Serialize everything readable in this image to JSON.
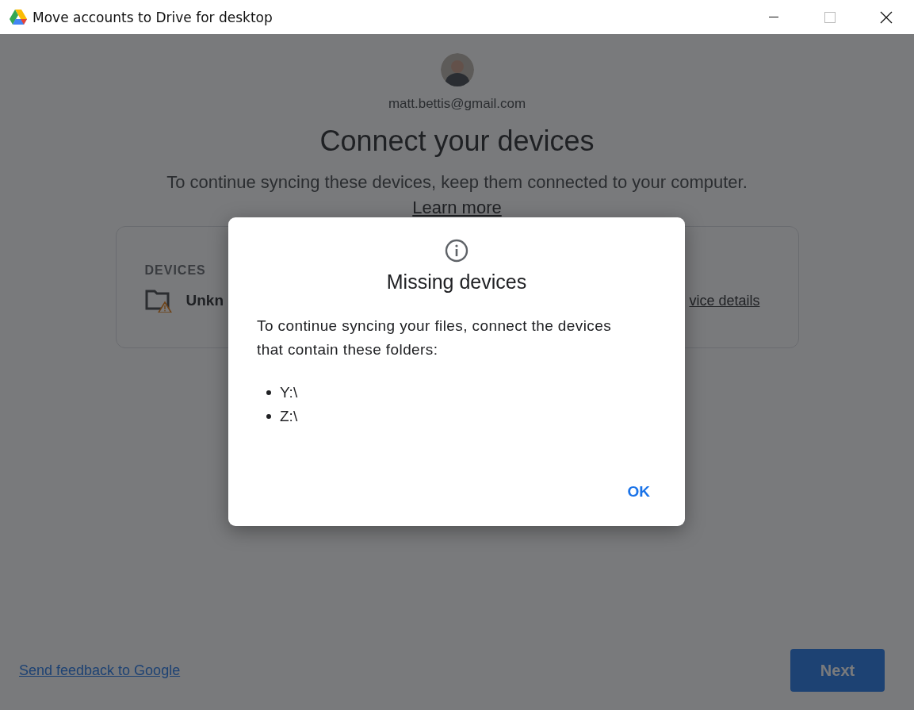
{
  "window": {
    "title": "Move accounts to Drive for desktop"
  },
  "account": {
    "email": "matt.bettis@gmail.com"
  },
  "heading": "Connect your devices",
  "description": "To continue syncing these devices, keep them connected to your computer.",
  "learn_more": "Learn more",
  "devices": {
    "label": "DEVICES",
    "items": [
      {
        "name": "Unkn",
        "warning": true,
        "link": "vice details"
      }
    ]
  },
  "feedback_link": "Send feedback to Google",
  "next_button": {
    "label": "Next"
  },
  "dialog": {
    "title": "Missing devices",
    "message": "To continue syncing your files, connect the devices that contain these folders:",
    "folders": [
      "Y:\\",
      "Z:\\"
    ],
    "ok_button": "OK"
  }
}
